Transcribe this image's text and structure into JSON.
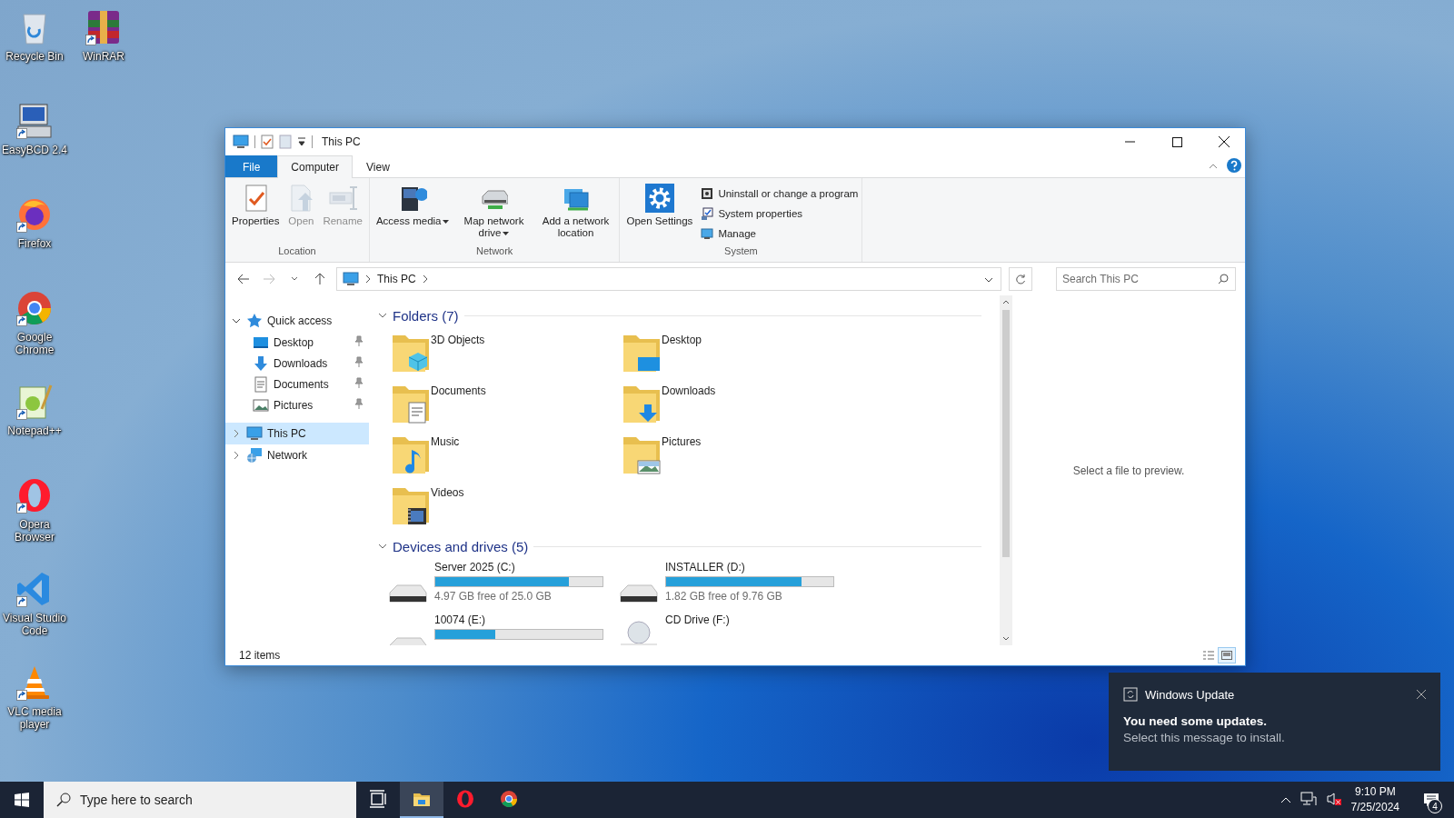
{
  "desktop_icons": [
    {
      "label": "Recycle Bin",
      "kind": "recycle-bin",
      "shortcut": false
    },
    {
      "label": "WinRAR",
      "kind": "winrar",
      "shortcut": true
    },
    {
      "label": "EasyBCD 2.4",
      "kind": "easybcd",
      "shortcut": true
    },
    {
      "label": "Firefox",
      "kind": "firefox",
      "shortcut": true
    },
    {
      "label": "Google Chrome",
      "kind": "chrome",
      "shortcut": true
    },
    {
      "label": "Notepad++",
      "kind": "notepadpp",
      "shortcut": true
    },
    {
      "label": "Opera Browser",
      "kind": "opera",
      "shortcut": true
    },
    {
      "label": "Visual Studio Code",
      "kind": "vscode",
      "shortcut": true
    },
    {
      "label": "VLC media player",
      "kind": "vlc",
      "shortcut": true
    }
  ],
  "window": {
    "title": "This PC",
    "tabs": [
      {
        "label": "File",
        "kind": "file",
        "selected": false
      },
      {
        "label": "Computer",
        "kind": "tab",
        "selected": true
      },
      {
        "label": "View",
        "kind": "tab",
        "selected": false
      }
    ],
    "ribbon": [
      {
        "label": "Location",
        "buttons": [
          {
            "label": "Properties",
            "kind": "properties",
            "disabled": false,
            "dropdown": false
          },
          {
            "label": "Open",
            "kind": "open",
            "disabled": true,
            "dropdown": false
          },
          {
            "label": "Rename",
            "kind": "rename",
            "disabled": true,
            "dropdown": false
          }
        ]
      },
      {
        "label": "Network",
        "buttons": [
          {
            "label": "Access media",
            "kind": "media",
            "disabled": false,
            "dropdown": true
          },
          {
            "label": "Map network drive",
            "kind": "map-drive",
            "disabled": false,
            "dropdown": true
          },
          {
            "label": "Add a network location",
            "kind": "net-location",
            "disabled": false,
            "dropdown": false
          }
        ]
      },
      {
        "label": "System",
        "buttons": [
          {
            "label": "Open Settings",
            "kind": "settings",
            "disabled": false,
            "dropdown": false
          }
        ],
        "links": [
          {
            "label": "Uninstall or change a program",
            "kind": "uninstall"
          },
          {
            "label": "System properties",
            "kind": "system"
          },
          {
            "label": "Manage",
            "kind": "manage"
          }
        ]
      }
    ],
    "address": {
      "path": [
        "This PC"
      ],
      "search_placeholder": "Search This PC"
    },
    "nav": [
      {
        "label": "Quick access",
        "kind": "star",
        "expanded": true,
        "selected": false,
        "children": [
          {
            "label": "Desktop",
            "kind": "desktop",
            "pinned": true,
            "selected": false
          },
          {
            "label": "Downloads",
            "kind": "downloads",
            "pinned": true,
            "selected": false
          },
          {
            "label": "Documents",
            "kind": "documents",
            "pinned": true,
            "selected": false
          },
          {
            "label": "Pictures",
            "kind": "pictures",
            "pinned": true,
            "selected": false
          }
        ]
      },
      {
        "label": "This PC",
        "kind": "pc",
        "expanded": false,
        "selected": true
      },
      {
        "label": "Network",
        "kind": "network",
        "expanded": false,
        "selected": false
      }
    ],
    "sections": [
      {
        "title": "Folders (7)",
        "expanded": true,
        "folders": [
          {
            "label": "3D Objects",
            "kind": "objects"
          },
          {
            "label": "Desktop",
            "kind": "desktop"
          },
          {
            "label": "Documents",
            "kind": "documents"
          },
          {
            "label": "Downloads",
            "kind": "downloads"
          },
          {
            "label": "Music",
            "kind": "music"
          },
          {
            "label": "Pictures",
            "kind": "pictures"
          },
          {
            "label": "Videos",
            "kind": "videos"
          }
        ]
      },
      {
        "title": "Devices and drives (5)",
        "expanded": true,
        "drives": [
          {
            "label": "Server 2025 (C:)",
            "kind": "hdd",
            "level": 0.8,
            "free": "4.97 GB free of 25.0 GB"
          },
          {
            "label": "INSTALLER (D:)",
            "kind": "hdd",
            "level": 0.81,
            "free": "1.82 GB free of 9.76 GB"
          },
          {
            "label": "10074 (E:)",
            "kind": "hdd",
            "level": 0.36
          },
          {
            "label": "CD Drive (F:)",
            "kind": "cd"
          }
        ]
      }
    ],
    "preview": "Select a file to preview.",
    "status": "12 items",
    "view_buttons": [
      {
        "kind": "details",
        "selected": false
      },
      {
        "kind": "large-icons",
        "selected": true
      }
    ]
  },
  "notification": {
    "app": "Windows Update",
    "title": "You need some updates.",
    "message": "Select this message to install."
  },
  "taskbar": {
    "search_placeholder": "Type here to search",
    "apps": [
      {
        "kind": "task-view",
        "active": false
      },
      {
        "kind": "explorer",
        "active": true
      },
      {
        "kind": "opera",
        "active": false
      },
      {
        "kind": "chrome",
        "active": false
      }
    ],
    "time": "9:10 PM",
    "date": "7/25/2024",
    "notification_count": "4"
  }
}
